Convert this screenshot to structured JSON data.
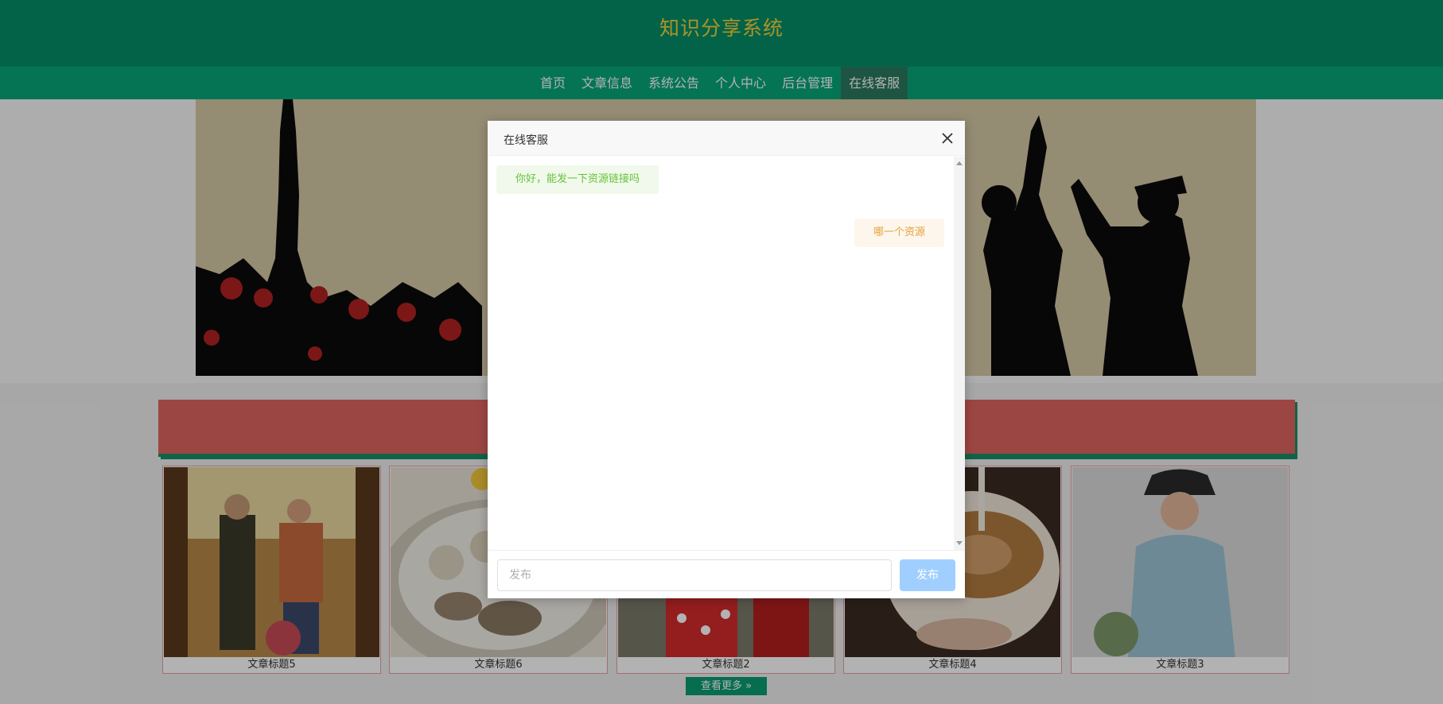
{
  "header": {
    "site_title": "知识分享系统"
  },
  "nav": {
    "items": [
      {
        "label": "首页"
      },
      {
        "label": "文章信息"
      },
      {
        "label": "系统公告"
      },
      {
        "label": "个人中心"
      },
      {
        "label": "后台管理"
      },
      {
        "label": "在线客服"
      }
    ],
    "active_index": 5
  },
  "articles": [
    {
      "title": "文章标题5"
    },
    {
      "title": "文章标题6"
    },
    {
      "title": "文章标题2"
    },
    {
      "title": "文章标题4"
    },
    {
      "title": "文章标题3"
    }
  ],
  "more_button": {
    "label": "查看更多"
  },
  "dialog": {
    "title": "在线客服",
    "messages": [
      {
        "side": "left",
        "text": "你好，能发一下资源链接吗"
      },
      {
        "side": "right",
        "text": "哪一个资源"
      }
    ],
    "input_placeholder": "发布",
    "send_label": "发布"
  },
  "colors": {
    "header_bg": "#048f68",
    "nav_bg": "#07a77a",
    "title_color": "#f7d23b",
    "stripe": "#e06560",
    "send_button": "#a0cfff"
  }
}
